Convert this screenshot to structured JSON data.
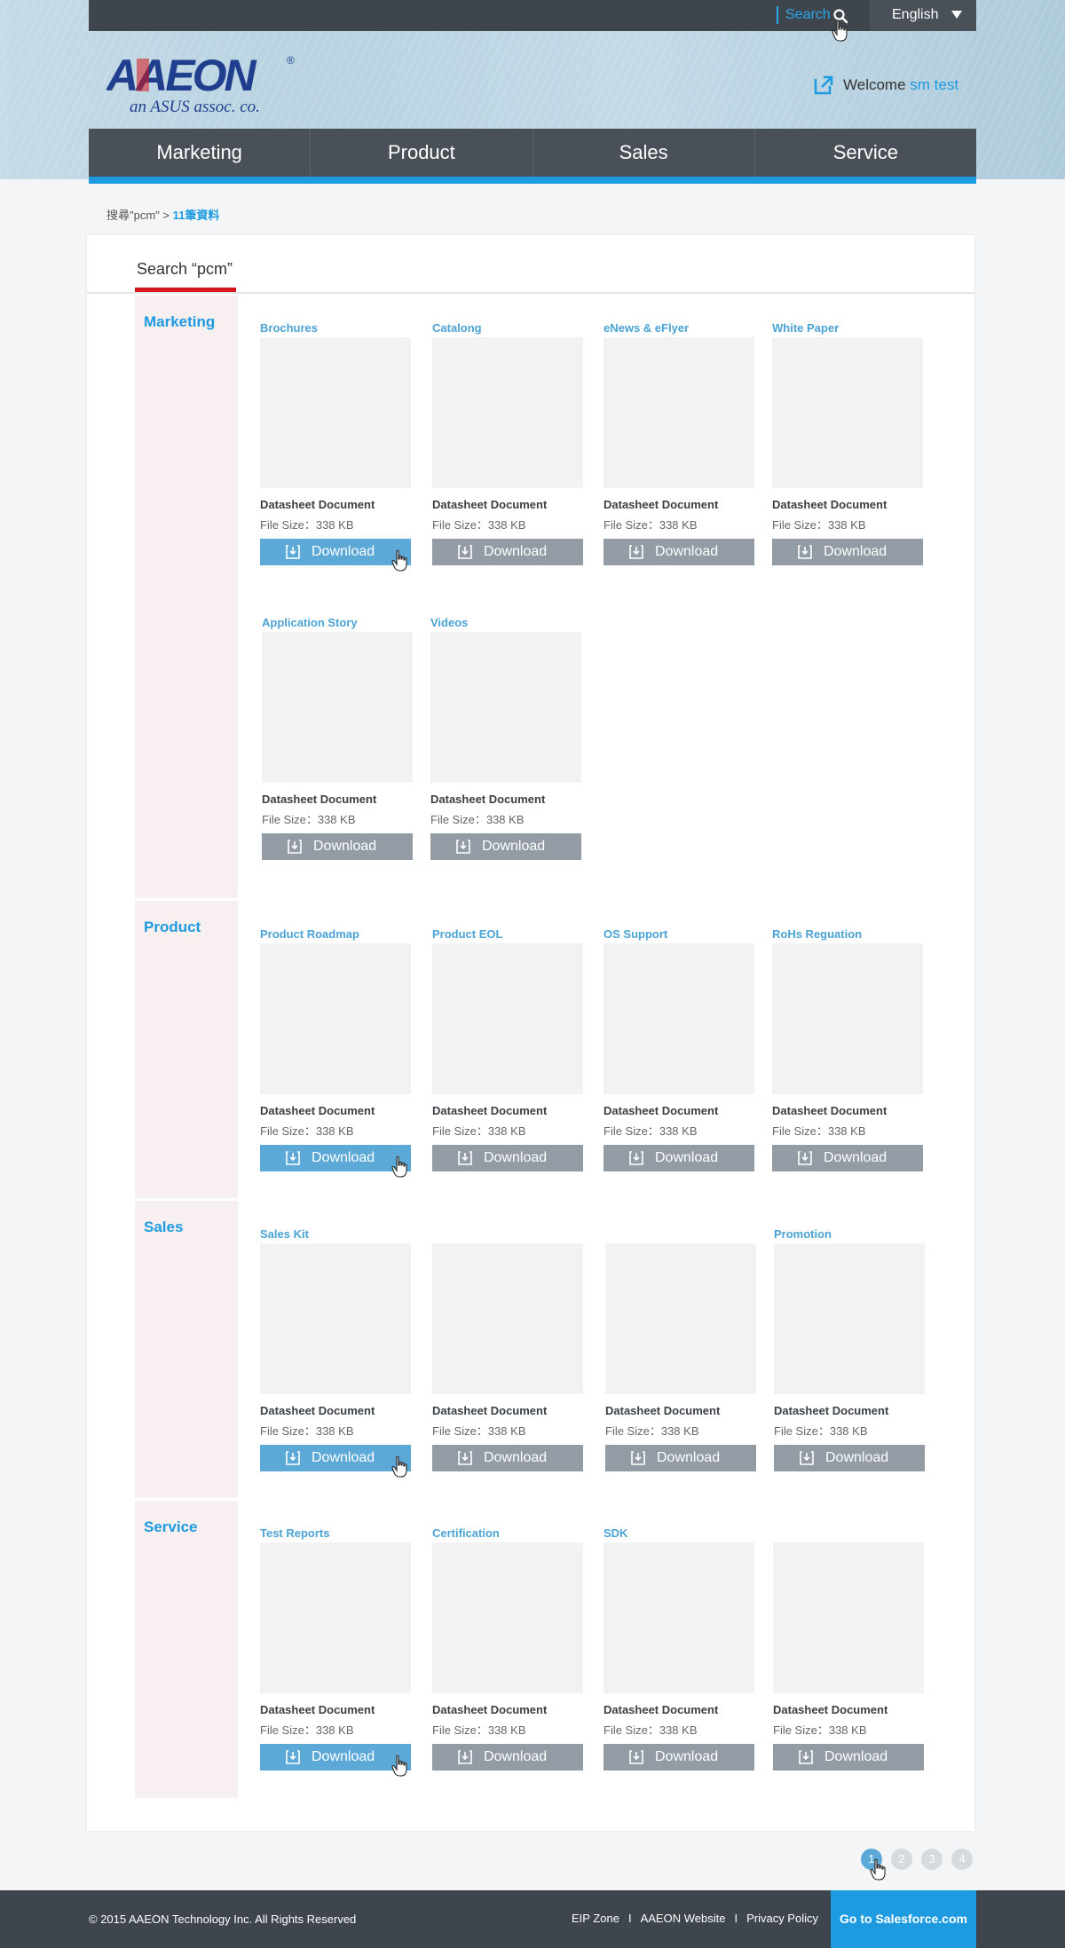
{
  "topbar": {
    "search_label": "Search",
    "language": "English"
  },
  "brand": {
    "logo_text": "AAEON",
    "logo_tagline": "an ASUS assoc. co."
  },
  "user": {
    "welcome_label": "Welcome",
    "name": "sm test"
  },
  "nav": {
    "items": [
      "Marketing",
      "Product",
      "Sales",
      "Service"
    ]
  },
  "breadcrumb": {
    "query": "搜尋\"pcm\"",
    "separator": ">",
    "result_count": "11筆資料"
  },
  "panel": {
    "title": "Search “pcm”"
  },
  "sections": [
    {
      "label": "Marketing",
      "cards": [
        {
          "title": "Brochures",
          "name": "Datasheet Document",
          "size": "File Size：338 KB",
          "button": "Download"
        },
        {
          "title": "Catalong",
          "name": "Datasheet Document",
          "size": "File Size：338 KB",
          "button": "Download"
        },
        {
          "title": "eNews & eFlyer",
          "name": "Datasheet Document",
          "size": "File Size：338 KB",
          "button": "Download"
        },
        {
          "title": "White Paper",
          "name": "Datasheet Document",
          "size": "File Size：338 KB",
          "button": "Download"
        },
        {
          "title": "Application Story",
          "name": "Datasheet Document",
          "size": "File Size：338 KB",
          "button": "Download"
        },
        {
          "title": "Videos",
          "name": "Datasheet Document",
          "size": "File Size：338 KB",
          "button": "Download"
        }
      ]
    },
    {
      "label": "Product",
      "cards": [
        {
          "title": "Product Roadmap",
          "name": "Datasheet Document",
          "size": "File Size：338 KB",
          "button": "Download"
        },
        {
          "title": "Product EOL",
          "name": "Datasheet Document",
          "size": "File Size：338 KB",
          "button": "Download"
        },
        {
          "title": "OS Support",
          "name": "Datasheet Document",
          "size": "File Size：338 KB",
          "button": "Download"
        },
        {
          "title": "RoHs Reguation",
          "name": "Datasheet Document",
          "size": "File Size：338 KB",
          "button": "Download"
        }
      ]
    },
    {
      "label": "Sales",
      "cards": [
        {
          "title": "Sales Kit",
          "name": "Datasheet Document",
          "size": "File Size：338 KB",
          "button": "Download"
        },
        {
          "title": "",
          "name": "Datasheet Document",
          "size": "File Size：338 KB",
          "button": "Download"
        },
        {
          "title": "",
          "name": "Datasheet Document",
          "size": "File Size：338 KB",
          "button": "Download"
        },
        {
          "title": "Promotion",
          "name": "Datasheet Document",
          "size": "File Size：338 KB",
          "button": "Download"
        }
      ]
    },
    {
      "label": "Service",
      "cards": [
        {
          "title": "Test Reports",
          "name": "Datasheet Document",
          "size": "File Size：338 KB",
          "button": "Download"
        },
        {
          "title": "Certification",
          "name": "Datasheet Document",
          "size": "File Size：338 KB",
          "button": "Download"
        },
        {
          "title": "SDK",
          "name": "Datasheet Document",
          "size": "File Size：338 KB",
          "button": "Download"
        },
        {
          "title": "",
          "name": "Datasheet Document",
          "size": "File Size：338 KB",
          "button": "Download"
        }
      ]
    }
  ],
  "pagination": {
    "pages": [
      "1",
      "2",
      "3",
      "4"
    ],
    "current": "1"
  },
  "footer": {
    "copyright": "© 2015 AAEON Technology Inc. All Rights Reserved",
    "links": [
      "EIP Zone",
      "AAEON Website",
      "Privacy Policy"
    ],
    "separator": "I",
    "salesforce_button": "Go to Salesforce.com"
  },
  "colors": {
    "accent": "#1e9be0",
    "nav_bg": "#4a5058",
    "topbar_bg": "#3f454d",
    "section_bg": "#f7eff0",
    "button_active": "#5ca9d8",
    "button_default": "#939ca4",
    "title_underline": "#d7161c"
  },
  "icons": [
    "search-icon",
    "caret-down-icon",
    "external-link-icon",
    "download-icon",
    "hand-cursor-icon"
  ]
}
